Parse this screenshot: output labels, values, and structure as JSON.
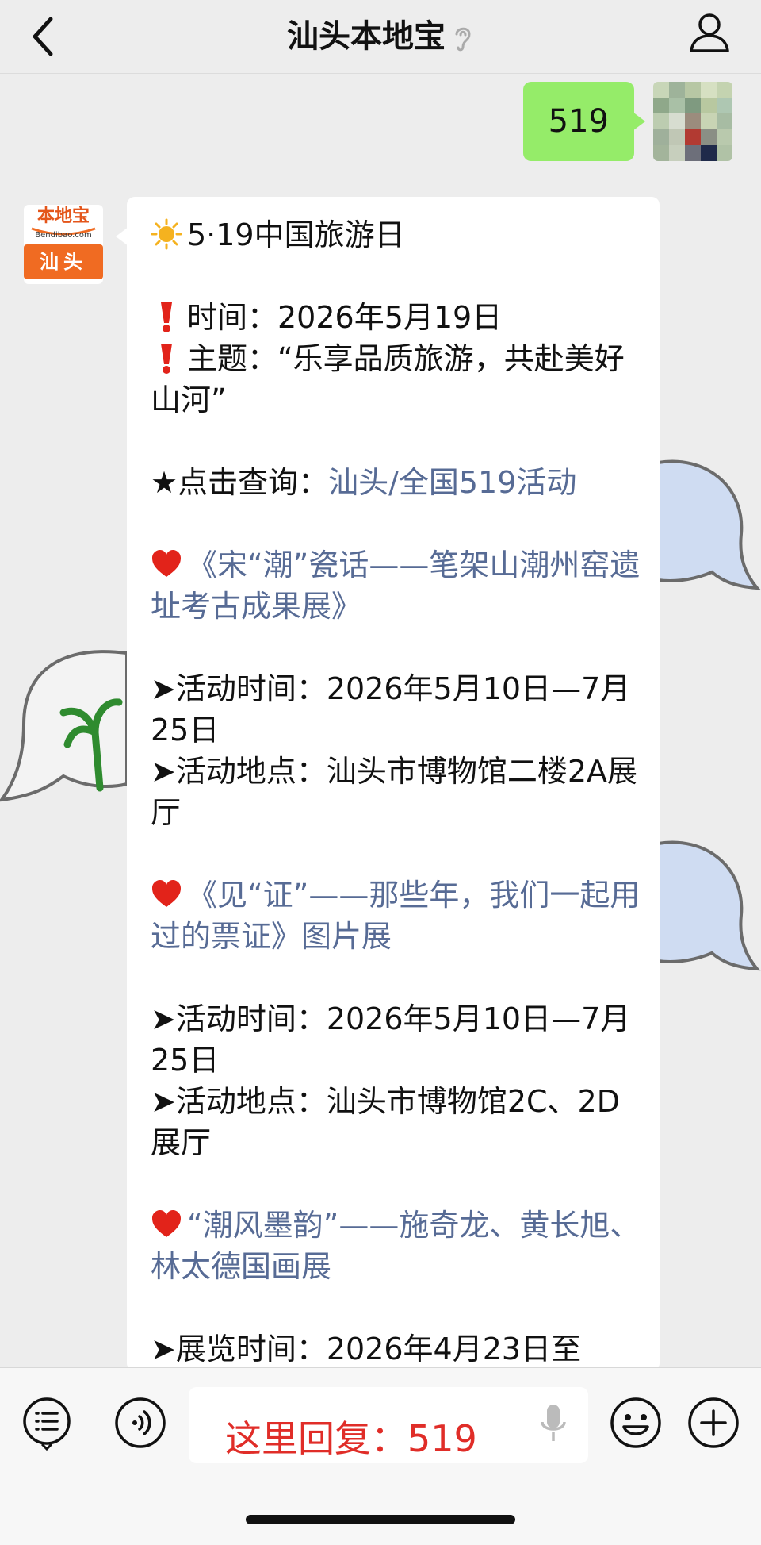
{
  "header": {
    "title": "汕头本地宝",
    "back_icon": "chevron-left-icon",
    "listen_icon": "ear-icon",
    "profile_icon": "person-icon"
  },
  "my_message": {
    "text": "519",
    "bubble_color": "#95ec69"
  },
  "bot_avatar": {
    "top_text": "本地宝",
    "sub_text": "Bendibao.com",
    "city_text": "汕头",
    "brand_color": "#f06b22"
  },
  "article": {
    "title": "5·19中国旅游日",
    "date_line": "时间：2026年5月19日",
    "theme_line": "主题：“乐享品质旅游，共赴美好山河”",
    "query_prefix": "★点击查询：",
    "query_link": "汕头/全国519活动",
    "events": [
      {
        "name": "《宋“潮”瓷话——笔架山潮州窑遗址考古成果展》",
        "time_line": "➤活动时间：2026年5月10日—7月25日",
        "place_line": "➤活动地点：汕头市博物馆二楼2A展厅"
      },
      {
        "name": "《见“证”——那些年，我们一起用过的票证》图片展",
        "time_line": "➤活动时间：2026年5月10日—7月25日",
        "place_line": "➤活动地点：汕头市博物馆2C、2D展厅"
      },
      {
        "name": "“潮风墨韵”——施奇龙、黄长旭、林太德国画展",
        "time_line": "➤展览时间：2026年4月23日至"
      }
    ],
    "link_color": "#576b95"
  },
  "toolbar": {
    "menu_icon": "menu-list-icon",
    "voice_icon": "voice-icon",
    "input_text": "这里回复：519",
    "mic_icon": "microphone-icon",
    "emoji_icon": "emoji-icon",
    "add_icon": "plus-circle-icon"
  }
}
